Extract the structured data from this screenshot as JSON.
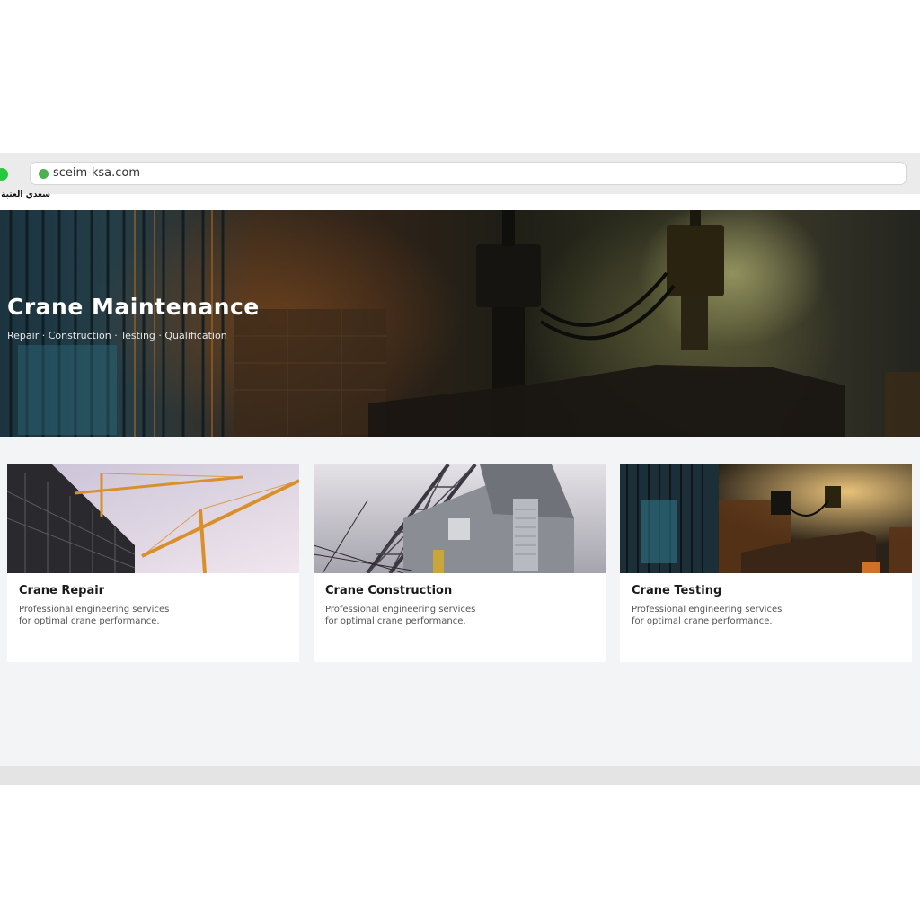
{
  "browser": {
    "url": "sceim-ksa.com"
  },
  "site": {
    "logo_text": "سعدي العتبة"
  },
  "hero": {
    "title": "Crane Maintenance",
    "subtitle": "Repair · Construction · Testing · Qualification"
  },
  "cards": [
    {
      "title": "Crane Repair",
      "description": "Professional engineering services for optimal crane performance."
    },
    {
      "title": "Crane Construction",
      "description": "Professional engineering services for optimal crane performance."
    },
    {
      "title": "Crane Testing",
      "description": "Professional engineering services for optimal crane performance."
    }
  ],
  "colors": {
    "page_background": "#f3f4f6",
    "card_background": "#ffffff",
    "address_dot": "#4caf50",
    "window_dot": "#27c93f"
  }
}
